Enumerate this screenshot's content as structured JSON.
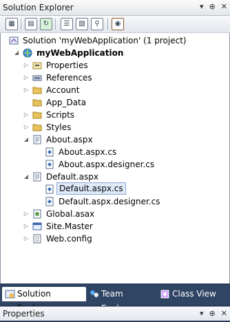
{
  "panel": {
    "title": "Solution Explorer",
    "controls": [
      "pin-dropdown-icon",
      "auto-hide-pin-icon",
      "close-icon"
    ]
  },
  "toolbar": {
    "buttons": [
      "properties-icon",
      "show-all-files-icon",
      "refresh-icon",
      "view-code-icon",
      "view-designer-icon",
      "copy-website-icon",
      "aspnet-configuration-icon"
    ]
  },
  "tree": {
    "solution_label": "Solution 'myWebApplication' (1 project)",
    "project_label": "myWebApplication",
    "items": [
      {
        "label": "Properties"
      },
      {
        "label": "References"
      },
      {
        "label": "Account"
      },
      {
        "label": "App_Data"
      },
      {
        "label": "Scripts"
      },
      {
        "label": "Styles"
      },
      {
        "label": "About.aspx"
      },
      {
        "label": "About.aspx.cs"
      },
      {
        "label": "About.aspx.designer.cs"
      },
      {
        "label": "Default.aspx"
      },
      {
        "label": "Default.aspx.cs"
      },
      {
        "label": "Default.aspx.designer.cs"
      },
      {
        "label": "Global.asax"
      },
      {
        "label": "Site.Master"
      },
      {
        "label": "Web.config"
      }
    ],
    "selected_item": "Default.aspx.cs"
  },
  "bottom_tabs": [
    {
      "label": "Solution Explorer",
      "active": true
    },
    {
      "label": "Team Explorer",
      "active": false
    },
    {
      "label": "Class View",
      "active": false
    }
  ],
  "properties_panel": {
    "title": "Properties"
  },
  "colors": {
    "chrome_dark": "#2b3c5a",
    "selection_fill": "#dfe9f7",
    "selection_border": "#8ca8d8",
    "folder": "#e8c25a",
    "cs_file": "#3a6fb8"
  }
}
